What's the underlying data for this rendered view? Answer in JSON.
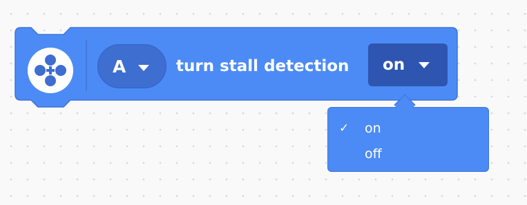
{
  "block": {
    "color": "#4c8bf5",
    "icon": "motor-icon",
    "port": "A",
    "text": "turn stall detection",
    "value": "on"
  },
  "menu": {
    "items": [
      {
        "label": "on",
        "checked": true,
        "check": "✓"
      },
      {
        "label": "off",
        "checked": false,
        "check": ""
      }
    ]
  }
}
